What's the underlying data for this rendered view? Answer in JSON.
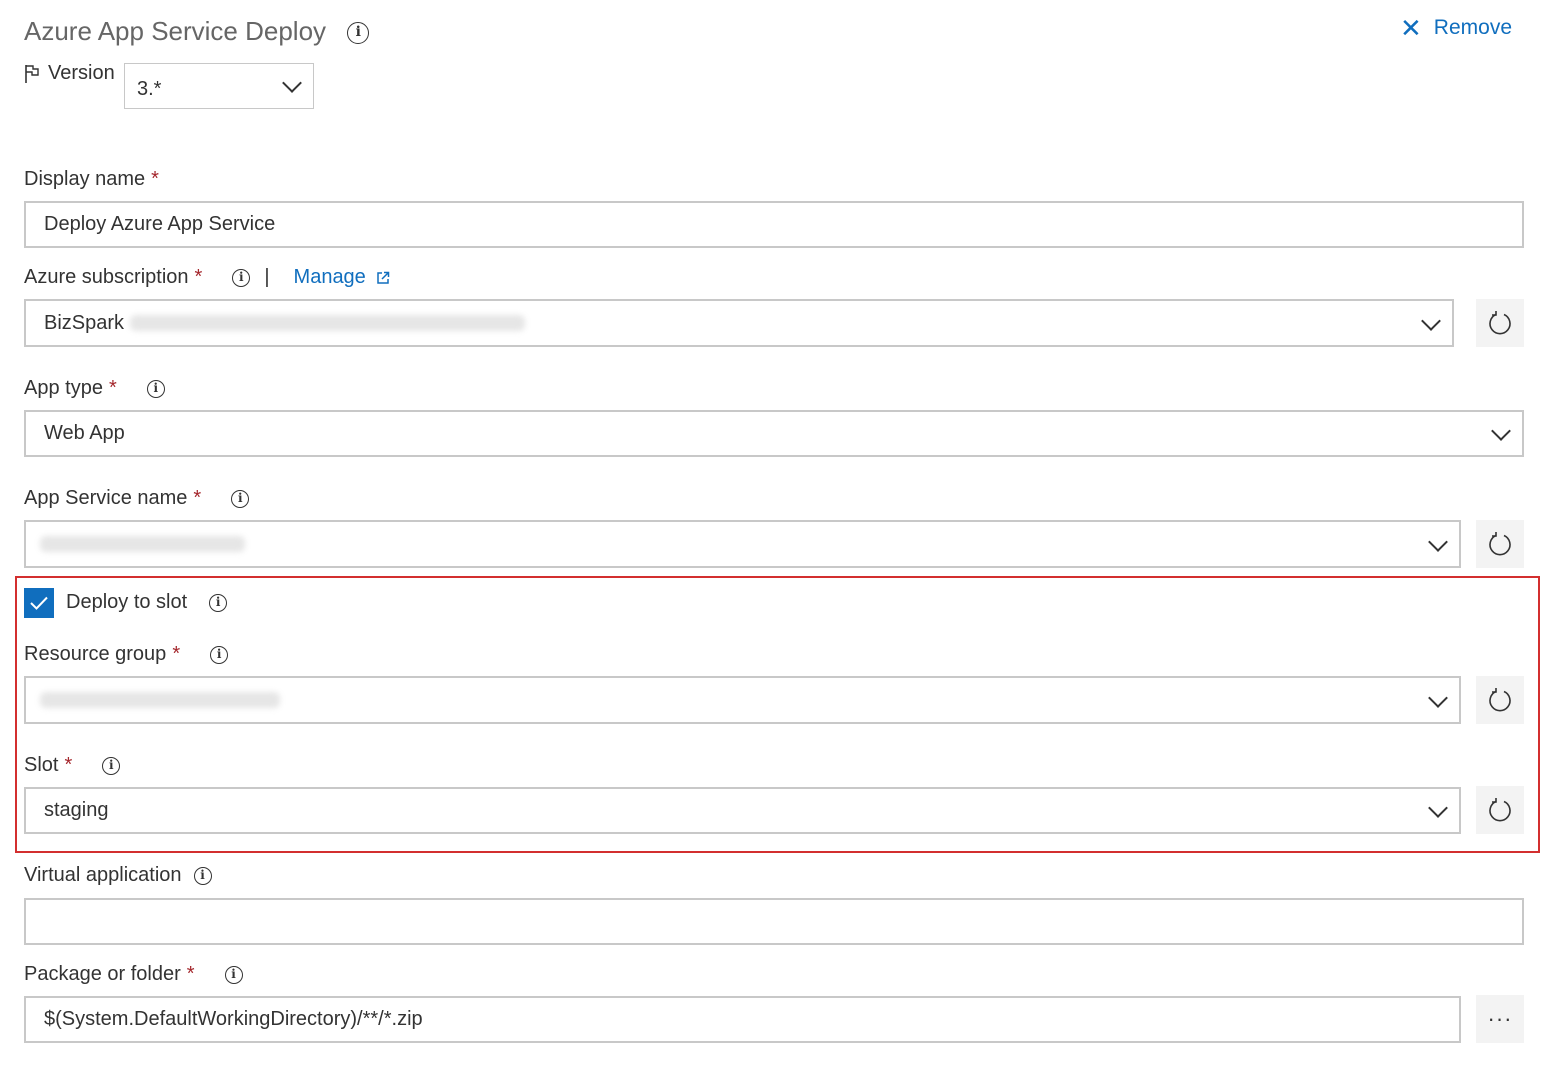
{
  "header": {
    "title": "Azure App Service Deploy",
    "remove_label": "Remove"
  },
  "version": {
    "label": "Version",
    "value": "3.*"
  },
  "display_name": {
    "label": "Display name",
    "required": "*",
    "value": "Deploy Azure App Service"
  },
  "azure_subscription": {
    "label": "Azure subscription",
    "required": "*",
    "separator": "|",
    "manage_label": "Manage",
    "value": "BizSpark"
  },
  "app_type": {
    "label": "App type",
    "required": "*",
    "value": "Web App"
  },
  "app_service_name": {
    "label": "App Service name",
    "required": "*",
    "value": ""
  },
  "deploy_to_slot": {
    "label": "Deploy to slot",
    "checked": true
  },
  "resource_group": {
    "label": "Resource group",
    "required": "*",
    "value": ""
  },
  "slot": {
    "label": "Slot",
    "required": "*",
    "value": "staging"
  },
  "virtual_application": {
    "label": "Virtual application",
    "value": ""
  },
  "package_or_folder": {
    "label": "Package or folder",
    "required": "*",
    "value": "$(System.DefaultWorkingDirectory)/**/*.zip",
    "browse_label": "···"
  },
  "colors": {
    "accent": "#106ebe",
    "required": "#a4262c",
    "highlight_border": "#d32f2f"
  }
}
